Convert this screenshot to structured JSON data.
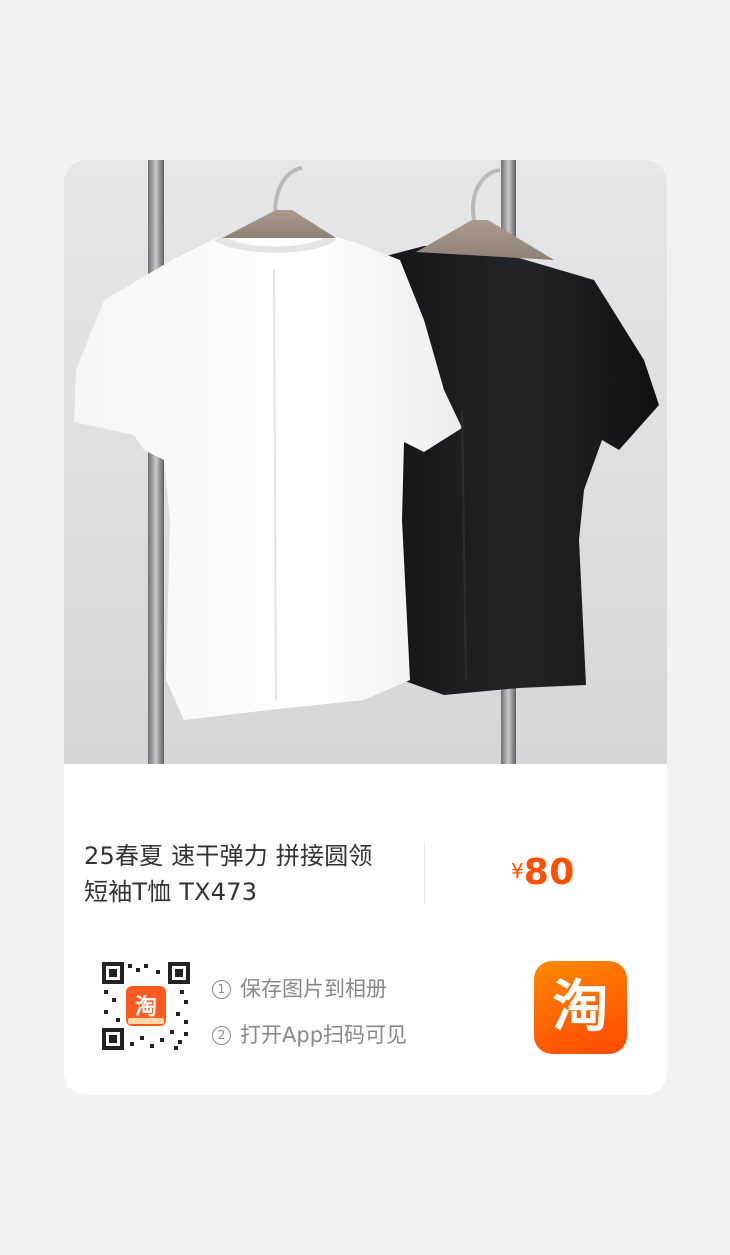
{
  "product": {
    "title_line1": "25春夏 速干弹力 拼接圆领",
    "title_line2": "短袖T恤 TX473",
    "currency": "¥",
    "price": "80"
  },
  "share": {
    "step1_num": "1",
    "step1_text": "保存图片到相册",
    "step2_num": "2",
    "step2_text": "打开App扫码可见",
    "qr_badge_text": "淘",
    "app_logo_text": "淘"
  },
  "colors": {
    "accent": "#ff5000",
    "text_primary": "#333333",
    "text_secondary": "#888888",
    "background": "#f2f2f2",
    "card": "#ffffff"
  },
  "icons": {
    "qr": "qr-code-icon",
    "app": "taobao-app-icon"
  }
}
